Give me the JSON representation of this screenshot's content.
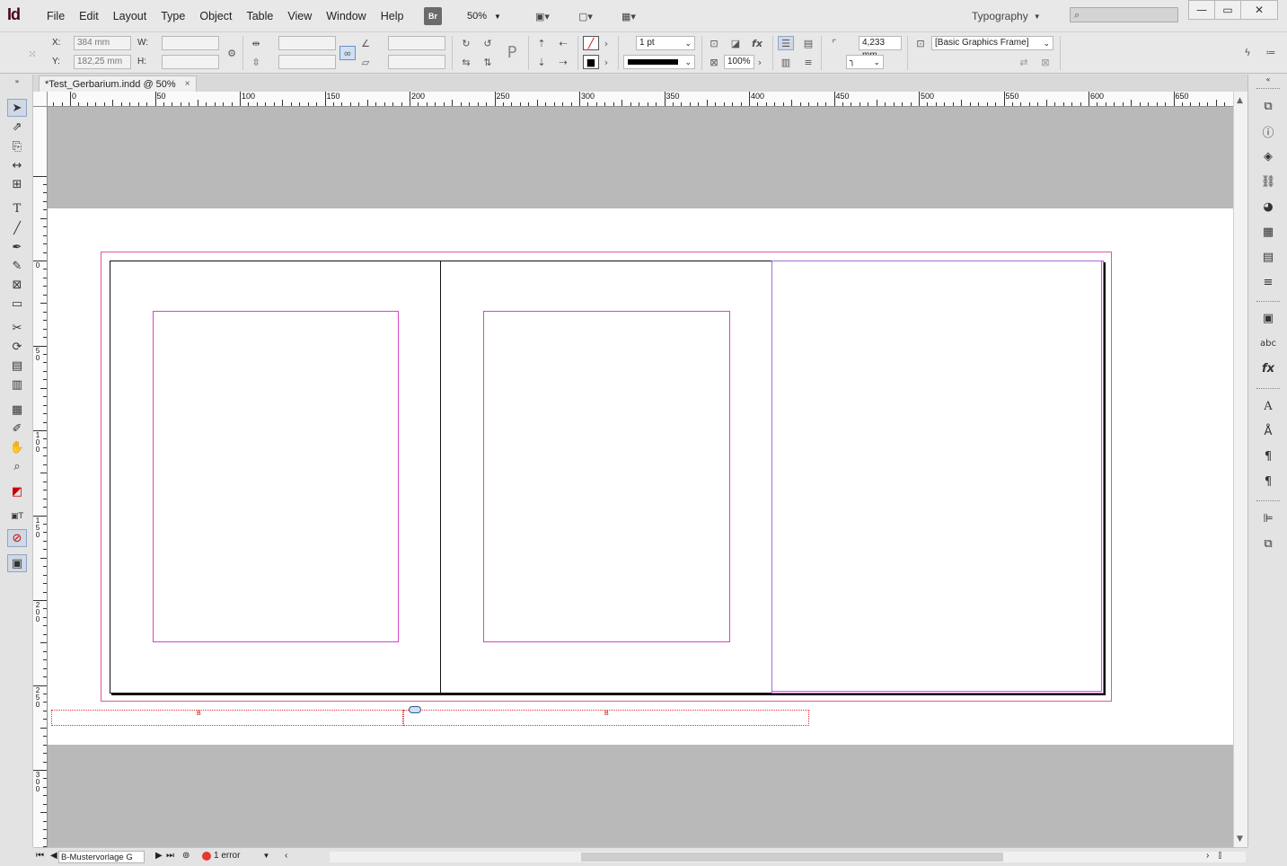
{
  "app": {
    "logo": "Id",
    "menu": [
      "File",
      "Edit",
      "Layout",
      "Type",
      "Object",
      "Table",
      "View",
      "Window",
      "Help"
    ],
    "bridge": "Br",
    "zoom": "50%",
    "workspace": "Typography",
    "window_controls": [
      "minimize",
      "maximize",
      "close"
    ]
  },
  "control_panel": {
    "x_label": "X:",
    "x_value": "384 mm",
    "y_label": "Y:",
    "y_value": "182,25 mm",
    "w_label": "W:",
    "w_value": "",
    "h_label": "H:",
    "h_value": "",
    "stroke_weight": "1 pt",
    "scale_percent": "100%",
    "gap_value": "4,233 mm",
    "object_style": "[Basic Graphics Frame]"
  },
  "document": {
    "tab_title": "*Test_Gerbarium.indd @ 50%",
    "tab_close": "×"
  },
  "ruler": {
    "h_labels": [
      "0",
      "50",
      "100",
      "150",
      "200",
      "250",
      "300",
      "350",
      "400",
      "450",
      "500",
      "550",
      "600",
      "650"
    ],
    "v_labels": [
      "0",
      "5 0",
      "1 0 0",
      "1 5 0",
      "2 0 0",
      "2 5 0",
      "3 0 0"
    ]
  },
  "slug_marks": [
    "B",
    "B"
  ],
  "status_bar": {
    "page_name": "B-Mustervorlage G",
    "error_text": "1 error"
  },
  "colors": {
    "bleed": "#e0569a",
    "margin": "#d845c9",
    "margin_alt": "#a66bd9",
    "pasteboard": "#b9b9b9",
    "error": "#e53a2f"
  }
}
